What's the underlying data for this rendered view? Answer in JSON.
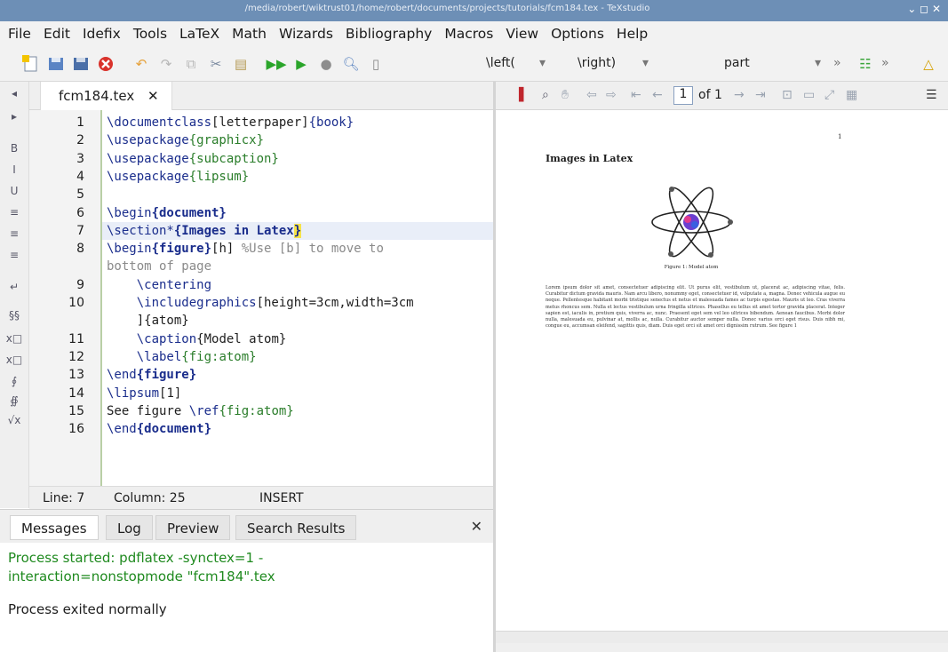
{
  "window": {
    "title": "/media/robert/wiktrust01/home/robert/documents/projects/tutorials/fcm184.tex - TeXstudio",
    "controls": "⌄ ◻ ✕"
  },
  "menu": [
    "File",
    "Edit",
    "Idefix",
    "Tools",
    "LaTeX",
    "Math",
    "Wizards",
    "Bibliography",
    "Macros",
    "View",
    "Options",
    "Help"
  ],
  "toolbar": {
    "left_delim": "\\left(",
    "right_delim": "\\right)",
    "section_level": "part",
    "arrow": "▾",
    "more": "»"
  },
  "left_icons": [
    "◂",
    "▸",
    "B",
    "I",
    "U",
    "≡",
    "≡",
    "≡",
    "↵",
    "§§",
    "x□",
    "x□",
    "∮",
    "∯",
    "√x"
  ],
  "editor": {
    "tab_name": "fcm184.tex",
    "close_symbol": "✕",
    "lines": [
      {
        "n": "1",
        "parts": [
          [
            "kw",
            "\\documentclass"
          ],
          [
            "",
            "[letterpaper]"
          ],
          [
            "kw",
            "{book}"
          ]
        ]
      },
      {
        "n": "2",
        "parts": [
          [
            "kw",
            "\\usepackage"
          ],
          [
            "arg",
            "{graphicx}"
          ]
        ]
      },
      {
        "n": "3",
        "parts": [
          [
            "kw",
            "\\usepackage"
          ],
          [
            "arg",
            "{subcaption}"
          ]
        ]
      },
      {
        "n": "4",
        "parts": [
          [
            "kw",
            "\\usepackage"
          ],
          [
            "arg",
            "{lipsum}"
          ]
        ]
      },
      {
        "n": "5",
        "parts": []
      },
      {
        "n": "6",
        "parts": [
          [
            "kw",
            "\\begin"
          ],
          [
            "kwb",
            "{document}"
          ]
        ]
      },
      {
        "n": "7",
        "parts": [
          [
            "kw",
            "\\section*"
          ],
          [
            "kwb",
            "{Images in Latex"
          ],
          [
            "cur",
            "}"
          ]
        ]
      },
      {
        "n": "8",
        "parts": [
          [
            "kw",
            "\\begin"
          ],
          [
            "kwb",
            "{figure}"
          ],
          [
            "",
            "[h] "
          ],
          [
            "cmt",
            "%Use [b] to move to"
          ]
        ]
      },
      {
        "n": "",
        "parts": [
          [
            "cmt",
            "bottom of page"
          ]
        ]
      },
      {
        "n": "9",
        "parts": [
          [
            "kw",
            "    \\centering"
          ]
        ]
      },
      {
        "n": "10",
        "parts": [
          [
            "kw",
            "    \\includegraphics"
          ],
          [
            "",
            "[height=3cm,width=3cm"
          ]
        ]
      },
      {
        "n": "",
        "parts": [
          [
            "",
            "    ]{atom}"
          ]
        ]
      },
      {
        "n": "11",
        "parts": [
          [
            "kw",
            "    \\caption"
          ],
          [
            "",
            "{Model atom}"
          ]
        ]
      },
      {
        "n": "12",
        "parts": [
          [
            "kw",
            "    \\label"
          ],
          [
            "arg",
            "{fig:atom}"
          ]
        ]
      },
      {
        "n": "13",
        "parts": [
          [
            "kw",
            "\\end"
          ],
          [
            "kwb",
            "{figure}"
          ]
        ]
      },
      {
        "n": "14",
        "parts": [
          [
            "kw",
            "\\lipsum"
          ],
          [
            "",
            "[1]"
          ]
        ]
      },
      {
        "n": "15",
        "parts": [
          [
            "",
            "See figure "
          ],
          [
            "kw",
            "\\ref"
          ],
          [
            "arg",
            "{fig:atom}"
          ]
        ]
      },
      {
        "n": "16",
        "parts": [
          [
            "kw",
            "\\end"
          ],
          [
            "kwb",
            "{document}"
          ]
        ]
      }
    ]
  },
  "status": {
    "line": "Line: 7",
    "column": "Column: 25",
    "mode": "INSERT"
  },
  "messages": {
    "tabs": [
      "Messages",
      "Log",
      "Preview",
      "Search Results"
    ],
    "close_symbol": "✕",
    "line1": "Process started: pdflatex -synctex=1 -",
    "line2": "interaction=nonstopmode \"fcm184\".tex",
    "line3": "Process exited normally"
  },
  "viewer": {
    "page_current": "1",
    "page_total": "of 1"
  },
  "pdf": {
    "page_number": "1",
    "heading": "Images in Latex",
    "caption": "Figure 1: Model atom",
    "body": "Lorem ipsum dolor sit amet, consectetuer adipiscing elit. Ut purus elit, vestibulum ut, placerat ac, adipiscing vitae, felis. Curabitur dictum gravida mauris. Nam arcu libero, nonummy eget, consectetuer id, vulputate a, magna. Donec vehicula augue eu neque. Pellentesque habitant morbi tristique senectus et netus et malesuada fames ac turpis egestas. Mauris ut leo. Cras viverra metus rhoncus sem. Nulla et lectus vestibulum urna fringilla ultrices. Phasellus eu tellus sit amet tortor gravida placerat. Integer sapien est, iaculis in, pretium quis, viverra ac, nunc. Praesent eget sem vel leo ultrices bibendum. Aenean faucibus. Morbi dolor nulla, malesuada eu, pulvinar at, mollis ac, nulla. Curabitur auctor semper nulla. Donec varius orci eget risus. Duis nibh mi, congue eu, accumsan eleifend, sagittis quis, diam. Duis eget orci sit amet orci dignissim rutrum. See figure 1"
  }
}
